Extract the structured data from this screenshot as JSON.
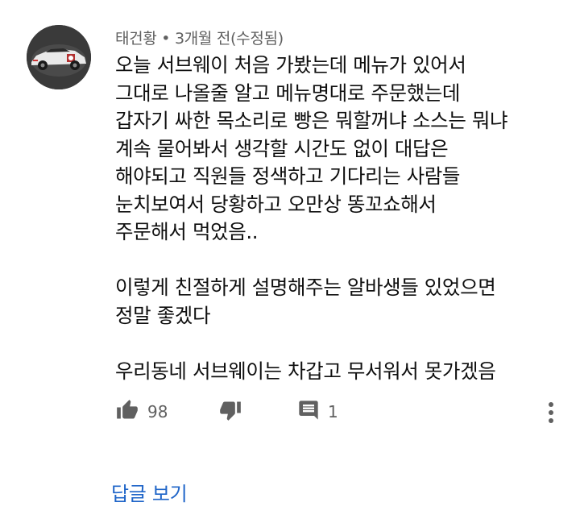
{
  "comment": {
    "author": "태건황",
    "separator": "•",
    "time": "3개월 전(수정됨)",
    "lines": [
      "오늘 서브웨이 처음 가봤는데 메뉴가 있어서",
      "그대로 나올줄 알고 메뉴명대로 주문했는데",
      "갑자기 싸한 목소리로 빵은 뭐할꺼냐 소스는 뭐냐",
      "계속 물어봐서 생각할 시간도 없이 대답은",
      "해야되고 직원들 정색하고 기다리는 사람들",
      "눈치보여서 당황하고 오만상 똥꼬쇼해서",
      "주문해서 먹었음..",
      "",
      "이렇게 친절하게 설명해주는 알바생들 있었으면",
      "정말 좋겠다",
      "",
      "우리동네 서브웨이는 차갑고 무서워서 못가겠음"
    ]
  },
  "actions": {
    "like_count": "98",
    "reply_count": "1"
  },
  "view_replies_label": "답글 보기",
  "icons": {
    "like": "thumbs-up-icon",
    "dislike": "thumbs-down-icon",
    "reply": "comment-icon",
    "more": "more-vertical-icon"
  },
  "colors": {
    "link": "#1e64c8",
    "secondary_text": "#606060",
    "icon": "#606060"
  }
}
